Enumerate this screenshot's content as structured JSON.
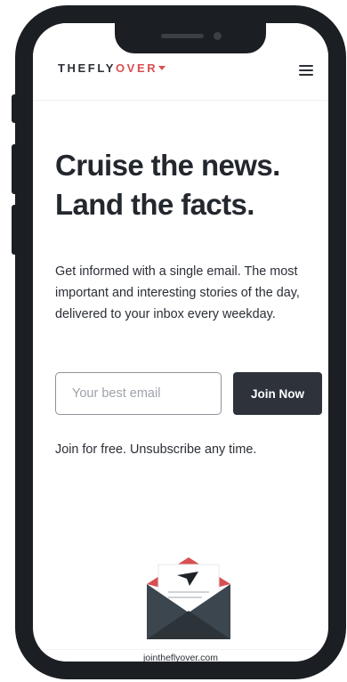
{
  "header": {
    "logo_part1": "THEFLY",
    "logo_part2": "OVER"
  },
  "hero": {
    "headline_line1": "Cruise the news.",
    "headline_line2": "Land the facts.",
    "intro": "Get informed with a single email. The most important and interesting stories of the day, delivered to your inbox every weekday."
  },
  "signup": {
    "email_placeholder": "Your best email",
    "join_label": "Join Now",
    "free_note": "Join for free. Unsubscribe any time."
  },
  "footer": {
    "url": "jointheflyover.com"
  },
  "icons": {
    "menu": "hamburger-menu-icon",
    "logo_mark": "plane-icon",
    "illustration": "envelope-icon"
  },
  "colors": {
    "brand_dark": "#2d323b",
    "brand_red": "#d84f52",
    "text": "#2b2f36"
  }
}
